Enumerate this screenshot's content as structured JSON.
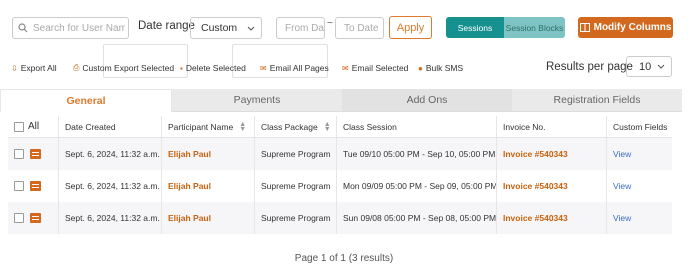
{
  "filters": {
    "search_placeholder": "Search for User Name",
    "date_range_label": "Date range",
    "date_range_value": "Custom",
    "from_placeholder": "From Date",
    "tilde": "~",
    "to_placeholder": "To Date",
    "apply_label": "Apply"
  },
  "view_toggle": {
    "sessions": "Sessions",
    "session_blocks": "Session Blocks"
  },
  "modify_columns_label": "Modify Columns",
  "actions": {
    "export_all": "Export All",
    "custom_export": "Custom Export Selected",
    "delete_selected": "Delete Selected",
    "email_all_pages": "Email All Pages",
    "email_selected": "Email Selected",
    "bulk_sms": "Bulk SMS"
  },
  "results_per_page": {
    "label": "Results per page",
    "value": "10"
  },
  "tabs": [
    "General",
    "Payments",
    "Add Ons",
    "Registration Fields"
  ],
  "table": {
    "all_label": "All",
    "columns": [
      "Date Created",
      "Participant Name",
      "Class Package",
      "Class Session",
      "Invoice No.",
      "Custom Fields"
    ],
    "rows": [
      {
        "date": "Sept. 6, 2024, 11:32 a.m.",
        "participant": "Elijah Paul",
        "package": "Supreme Program",
        "session": "Tue 09/10 05:00 PM - Sep 10, 05:00 PM",
        "invoice": "Invoice #540343",
        "custom": "View"
      },
      {
        "date": "Sept. 6, 2024, 11:32 a.m.",
        "participant": "Elijah Paul",
        "package": "Supreme Program",
        "session": "Mon 09/09 05:00 PM - Sep 09, 05:00 PM",
        "invoice": "Invoice #540343",
        "custom": "View"
      },
      {
        "date": "Sept. 6, 2024, 11:32 a.m.",
        "participant": "Elijah Paul",
        "package": "Supreme Program",
        "session": "Sun 09/08 05:00 PM - Sep 08, 05:00 PM",
        "invoice": "Invoice #540343",
        "custom": "View"
      }
    ]
  },
  "pagination": "Page 1 of 1 (3 results)",
  "colors": {
    "accent": "#d2691e",
    "teal": "#17918f",
    "teal_light": "#7fc4c4",
    "link": "#3a6fc4"
  }
}
